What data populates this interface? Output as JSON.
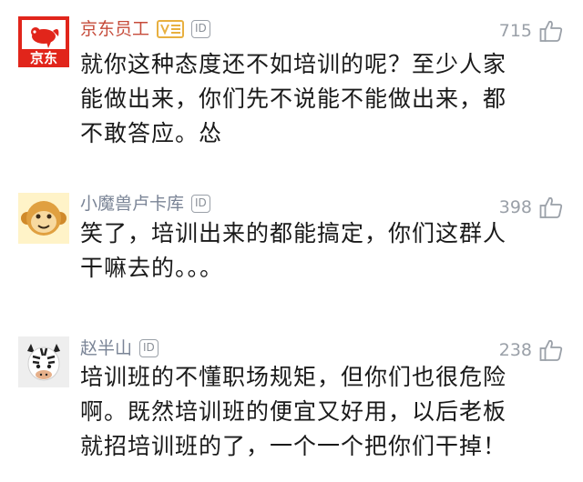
{
  "comments": [
    {
      "username": "京东员工",
      "badge_id": "ID",
      "likes": "715",
      "avatar_logo_text": "京东",
      "text": "就你这种态度还不如培训的呢？至少人家能做出来，你们先不说能不能做出来，都不敢答应。怂"
    },
    {
      "username": "小魔兽卢卡库",
      "badge_id": "ID",
      "likes": "398",
      "text": "笑了，培训出来的都能搞定，你们这群人干嘛去的。。。"
    },
    {
      "username": "赵半山",
      "badge_id": "ID",
      "likes": "238",
      "text": "培训班的不懂职场规矩，但你们也很危险啊。既然培训班的便宜又好用，以后老板就招培训班的了，一个一个把你们干掉！"
    }
  ],
  "colors": {
    "vip_name": "#c64b3a",
    "normal_name": "#7a8496",
    "jd_red": "#e1251b",
    "text": "#1a1a1a",
    "meta_gray": "#9aa0a8"
  },
  "icons": {
    "like": "thumbs-up-icon",
    "verified": "verified-badge-icon"
  }
}
